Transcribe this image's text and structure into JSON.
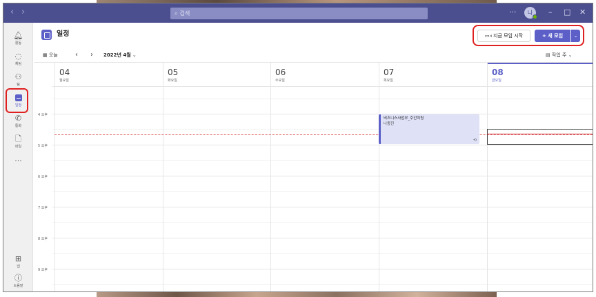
{
  "titlebar": {
    "back": "‹",
    "forward": "›",
    "search_placeholder": "검색",
    "more": "···",
    "avatar_initials": "나",
    "minimize": "–",
    "maximize": "□",
    "close": "✕"
  },
  "rail": {
    "items": [
      {
        "label": "활동",
        "icon": "bell-icon"
      },
      {
        "label": "채팅",
        "icon": "chat-icon"
      },
      {
        "label": "팀",
        "icon": "teams-icon"
      },
      {
        "label": "일정",
        "icon": "calendar-icon",
        "active": true
      },
      {
        "label": "통화",
        "icon": "phone-icon"
      },
      {
        "label": "파일",
        "icon": "file-icon"
      },
      {
        "label": "···",
        "icon": "more-icon"
      }
    ],
    "bottom": [
      {
        "label": "앱",
        "icon": "apps-icon"
      },
      {
        "label": "도움말",
        "icon": "help-icon"
      }
    ]
  },
  "header": {
    "title": "일정",
    "meet_now_label": "지금 모임 시작",
    "new_meeting_label": "+ 새 모임",
    "new_meeting_dropdown": "⌄"
  },
  "toolbar": {
    "today_label": "오늘",
    "prev": "‹",
    "next": "›",
    "date_range": "2022년 4월",
    "view_label": "작업 주"
  },
  "calendar": {
    "days": [
      {
        "num": "04",
        "weekday": "월요일"
      },
      {
        "num": "05",
        "weekday": "화요일"
      },
      {
        "num": "06",
        "weekday": "수요일"
      },
      {
        "num": "07",
        "weekday": "목요일"
      },
      {
        "num": "08",
        "weekday": "금요일",
        "today": true
      }
    ],
    "hours": [
      "4 오후",
      "5 오후",
      "6 오후",
      "7 오후",
      "8 오후",
      "9 오후"
    ],
    "event": {
      "title": "비즈니스사업부_주간미팅",
      "organizer": "나종진",
      "recurring_icon": "⟲",
      "day_index": 3
    }
  },
  "colors": {
    "titlebar": "#4b4f8f",
    "accent": "#5b5fc7",
    "highlight": "#e02020",
    "event_bg": "#dfe1f7"
  }
}
